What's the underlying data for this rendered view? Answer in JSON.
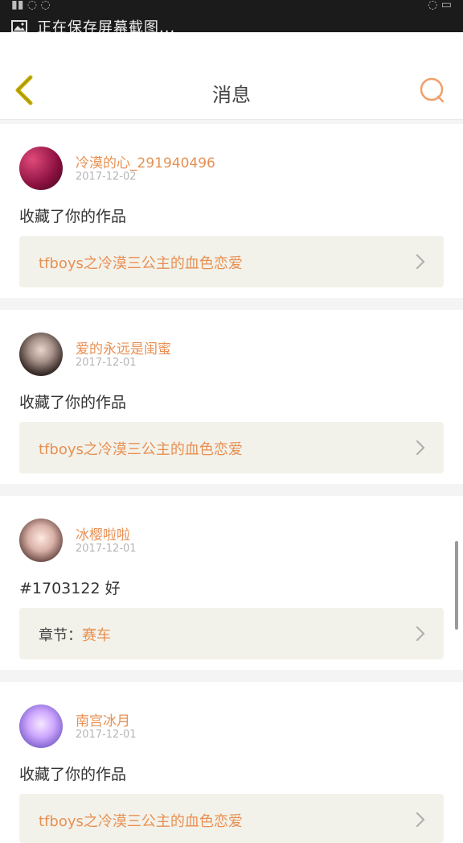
{
  "status": {
    "notification": "正在保存屏幕截图..."
  },
  "header": {
    "title": "消息"
  },
  "messages": [
    {
      "username": "冷漠的心_291940496",
      "date": "2017-12-02",
      "content": "收藏了你的作品",
      "link": {
        "prefix": "",
        "text": "tfboys之冷漠三公主的血色恋爱"
      }
    },
    {
      "username": "爱的永远是闺蜜",
      "date": "2017-12-01",
      "content": "收藏了你的作品",
      "link": {
        "prefix": "",
        "text": "tfboys之冷漠三公主的血色恋爱"
      }
    },
    {
      "username": "冰樱啦啦",
      "date": "2017-12-01",
      "content": "#1703122 好",
      "link": {
        "prefix": "章节：",
        "text": "赛车"
      }
    },
    {
      "username": "南宫冰月",
      "date": "2017-12-01",
      "content": "收藏了你的作品",
      "link": {
        "prefix": "",
        "text": "tfboys之冷漠三公主的血色恋爱"
      }
    }
  ],
  "colors": {
    "accent": "#e89053",
    "card_bg": "#ffffff",
    "link_box_bg": "#f3f2ea",
    "page_bg": "#f4f4f4"
  },
  "icons": {
    "back": "back-chevron-icon",
    "search": "search-icon",
    "chevron": "chevron-right-icon"
  }
}
